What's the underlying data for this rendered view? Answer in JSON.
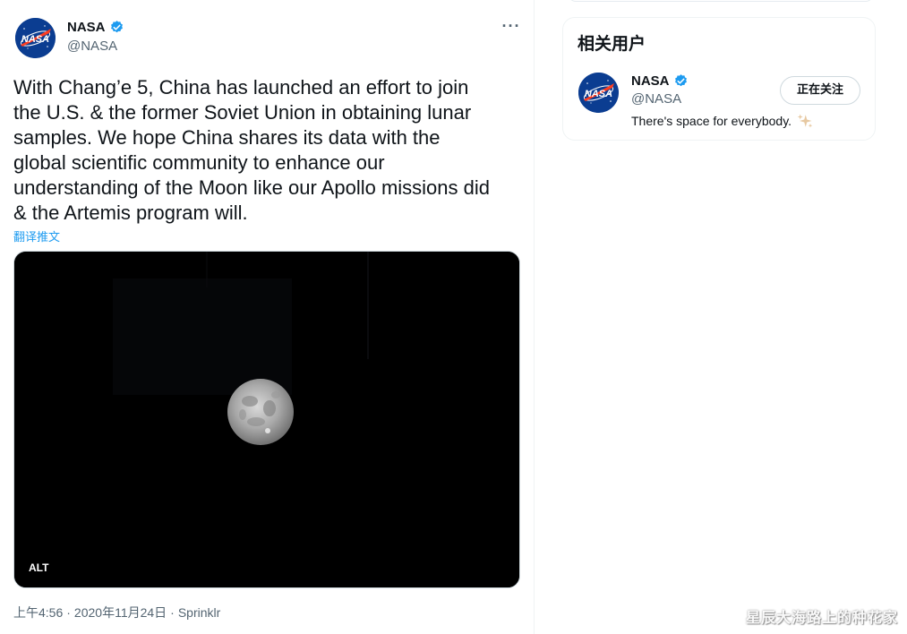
{
  "tweet": {
    "author_name": "NASA",
    "author_handle": "@NASA",
    "more_label": "···",
    "text": "With Chang’e 5, China has launched an effort to join\nthe U.S. & the former Soviet Union in obtaining lunar\nsamples. We hope China shares its data with the\nglobal scientific community to enhance our\nunderstanding of the Moon like our Apollo missions did\n& the Artemis program will.",
    "translate_label": "翻译推文",
    "media_alt_badge": "ALT",
    "time": "上午4:56",
    "separator": "·",
    "date": "2020年11月24日",
    "source": "Sprinklr"
  },
  "sidebar": {
    "related_title": "相关用户",
    "user": {
      "name": "NASA",
      "handle": "@NASA",
      "bio": "There's space for everybody.",
      "follow_label": "正在关注"
    }
  },
  "watermark": "星辰大海路上的种花家",
  "colors": {
    "link": "#1d9bf0",
    "verified": "#1d9bf0",
    "muted": "#536471",
    "nasa_blue": "#0b3d91",
    "nasa_red": "#fc3d21"
  },
  "icons": {
    "verified": "verified-badge-icon",
    "sparkle": "sparkles-icon",
    "more": "more-dots-icon"
  }
}
